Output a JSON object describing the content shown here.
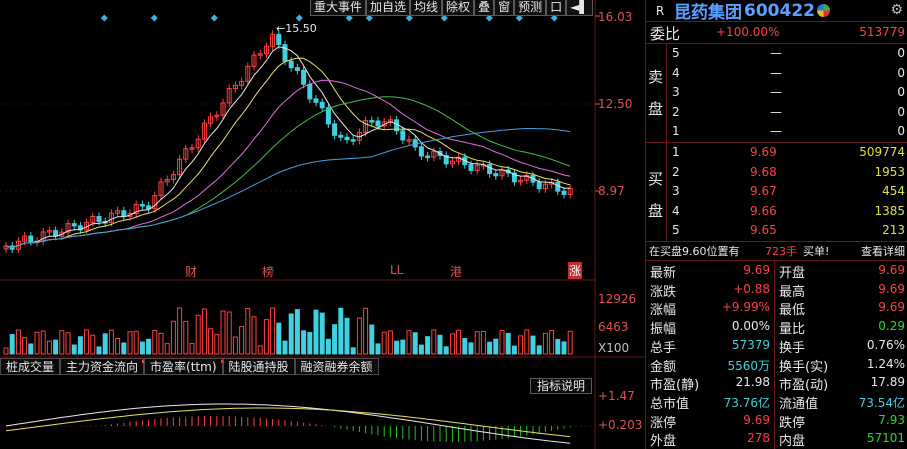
{
  "toolbar": {
    "items": [
      "重大事件",
      "加自选",
      "均线",
      "除权",
      "叠",
      "窗",
      "预测",
      "口"
    ],
    "nav_icon": "◄▌"
  },
  "price_axis": {
    "high": "16.03",
    "mid": "12.50",
    "low": "8.97"
  },
  "peak_label": "15.50",
  "volume_axis": {
    "high": "12926",
    "mid": "6463",
    "unit": "X100"
  },
  "indicator_axis": {
    "high": "+1.47",
    "mid": "+0.203"
  },
  "events": {
    "cai": "财",
    "bang": "榜",
    "ll": "LL",
    "gang": "港",
    "zhang": "涨"
  },
  "indicator_tabs": [
    "桩成交量",
    "主力资金流向",
    "市盈率(ttm)",
    "陆股通持股",
    "融资融券余额"
  ],
  "indicator_desc": "指标说明",
  "stock": {
    "r": "R",
    "name": "昆药集团",
    "code": "600422"
  },
  "weibi": {
    "label": "委比",
    "ratio": "+100.00%",
    "diff": "513779"
  },
  "sell": {
    "label1": "卖",
    "label2": "盘",
    "levels": [
      {
        "n": "5",
        "price": "—",
        "vol": "0"
      },
      {
        "n": "4",
        "price": "—",
        "vol": "0"
      },
      {
        "n": "3",
        "price": "—",
        "vol": "0"
      },
      {
        "n": "2",
        "price": "—",
        "vol": "0"
      },
      {
        "n": "1",
        "price": "—",
        "vol": "0"
      }
    ]
  },
  "buy": {
    "label1": "买",
    "label2": "盘",
    "levels": [
      {
        "n": "1",
        "price": "9.69",
        "vol": "509774"
      },
      {
        "n": "2",
        "price": "9.68",
        "vol": "1953"
      },
      {
        "n": "3",
        "price": "9.67",
        "vol": "454"
      },
      {
        "n": "4",
        "price": "9.66",
        "vol": "1385"
      },
      {
        "n": "5",
        "price": "9.65",
        "vol": "213"
      }
    ]
  },
  "notice": {
    "text": "在买盘9.60位置有",
    "hands": "723手",
    "action": "买单!",
    "detail": "查看详细"
  },
  "quote": [
    {
      "l1": "最新",
      "v1": "9.69",
      "c1": "red",
      "l2": "开盘",
      "v2": "9.69",
      "c2": "red"
    },
    {
      "l1": "涨跌",
      "v1": "+0.88",
      "c1": "red",
      "l2": "最高",
      "v2": "9.69",
      "c2": "red"
    },
    {
      "l1": "涨幅",
      "v1": "+9.99%",
      "c1": "red",
      "l2": "最低",
      "v2": "9.69",
      "c2": "red"
    },
    {
      "l1": "振幅",
      "v1": "0.00%",
      "c1": "white",
      "l2": "量比",
      "v2": "0.29",
      "c2": "green"
    },
    {
      "l1": "总手",
      "v1": "57379",
      "c1": "cyan",
      "l2": "换手",
      "v2": "0.76%",
      "c2": "white"
    },
    {
      "l1": "金额",
      "v1": "5560万",
      "c1": "cyan",
      "l2": "换手(实)",
      "v2": "1.24%",
      "c2": "white"
    },
    {
      "l1": "市盈(静)",
      "v1": "21.98",
      "c1": "white",
      "l2": "市盈(动)",
      "v2": "17.89",
      "c2": "white"
    },
    {
      "l1": "总市值",
      "v1": "73.76亿",
      "c1": "cyan",
      "l2": "流通值",
      "v2": "73.54亿",
      "c2": "cyan"
    },
    {
      "l1": "涨停",
      "v1": "9.69",
      "c1": "red",
      "l2": "跌停",
      "v2": "7.93",
      "c2": "green"
    },
    {
      "l1": "外盘",
      "v1": "278",
      "c1": "red",
      "l2": "内盘",
      "v2": "57101",
      "c2": "green"
    }
  ],
  "colors": {
    "up": "#ff4040",
    "down": "#40d0e0",
    "border": "#6a1515"
  }
}
